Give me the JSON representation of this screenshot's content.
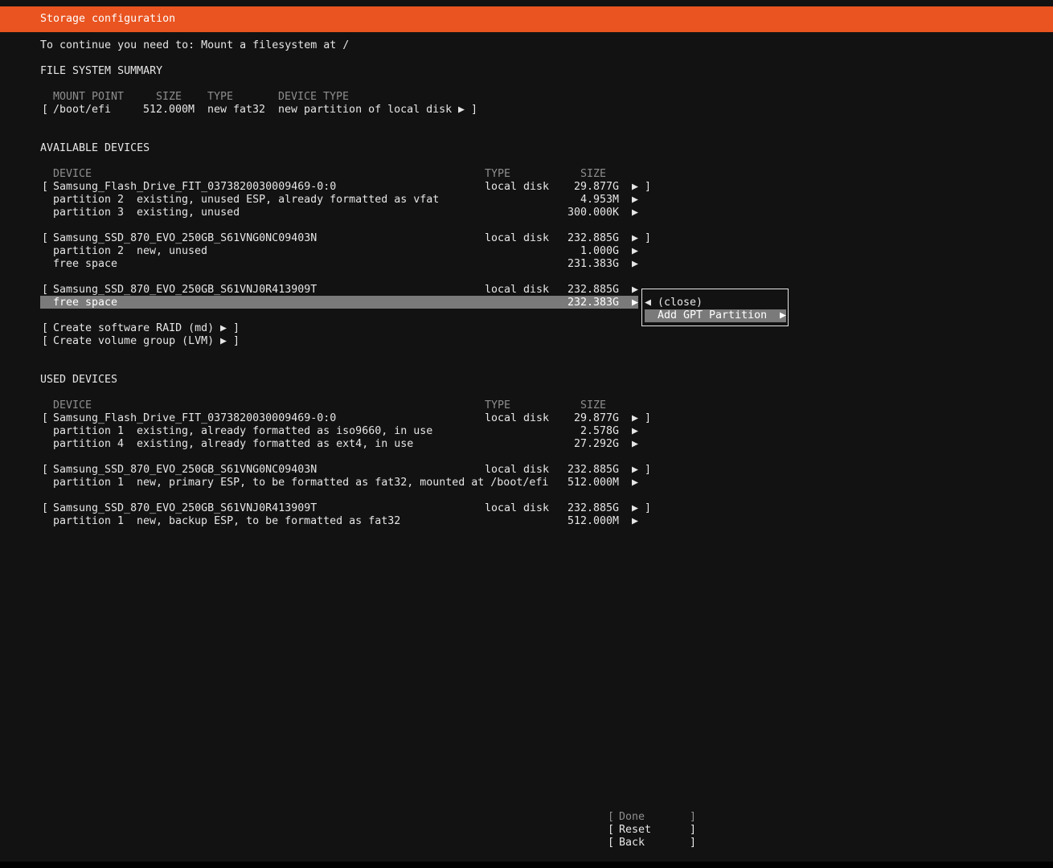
{
  "title_bar": {
    "title": "Storage configuration"
  },
  "instruction": "To continue you need to: Mount a filesystem at /",
  "fs_summary": {
    "heading": "FILE SYSTEM SUMMARY",
    "columns": {
      "mount_point": "MOUNT POINT",
      "size": "SIZE",
      "type": "TYPE",
      "device_type": "DEVICE TYPE"
    },
    "rows": [
      {
        "mount_point": "/boot/efi",
        "size": "512.000M",
        "type": "new fat32",
        "device_type": "new partition of local disk"
      }
    ]
  },
  "available_devices": {
    "heading": "AVAILABLE DEVICES",
    "columns": {
      "device": "DEVICE",
      "type": "TYPE",
      "size": "SIZE"
    },
    "disks": [
      {
        "name": "Samsung_Flash_Drive_FIT_0373820030009469-0:0",
        "type": "local disk",
        "size": "29.877G",
        "partitions": [
          {
            "label": "partition 2",
            "desc": "existing, unused ESP, already formatted as vfat",
            "size": "4.953M"
          },
          {
            "label": "partition 3",
            "desc": "existing, unused",
            "size": "300.000K"
          }
        ]
      },
      {
        "name": "Samsung_SSD_870_EVO_250GB_S61VNG0NC09403N",
        "type": "local disk",
        "size": "232.885G",
        "partitions": [
          {
            "label": "partition 2",
            "desc": "new, unused",
            "size": "1.000G"
          },
          {
            "label": "free space",
            "desc": "",
            "size": "231.383G"
          }
        ]
      },
      {
        "name": "Samsung_SSD_870_EVO_250GB_S61VNJ0R413909T",
        "type": "local disk",
        "size": "232.885G",
        "partitions": [
          {
            "label": "free space",
            "desc": "",
            "size": "232.383G"
          }
        ]
      }
    ],
    "actions": {
      "create_raid": "Create software RAID (md)",
      "create_lvm": "Create volume group (LVM)"
    }
  },
  "context_menu": {
    "close": "(close)",
    "add_gpt": "Add GPT Partition"
  },
  "used_devices": {
    "heading": "USED DEVICES",
    "columns": {
      "device": "DEVICE",
      "type": "TYPE",
      "size": "SIZE"
    },
    "disks": [
      {
        "name": "Samsung_Flash_Drive_FIT_0373820030009469-0:0",
        "type": "local disk",
        "size": "29.877G",
        "partitions": [
          {
            "label": "partition 1",
            "desc": "existing, already formatted as iso9660, in use",
            "size": "2.578G"
          },
          {
            "label": "partition 4",
            "desc": "existing, already formatted as ext4, in use",
            "size": "27.292G"
          }
        ]
      },
      {
        "name": "Samsung_SSD_870_EVO_250GB_S61VNG0NC09403N",
        "type": "local disk",
        "size": "232.885G",
        "partitions": [
          {
            "label": "partition 1",
            "desc": "new, primary ESP, to be formatted as fat32, mounted at /boot/efi",
            "size": "512.000M"
          }
        ]
      },
      {
        "name": "Samsung_SSD_870_EVO_250GB_S61VNJ0R413909T",
        "type": "local disk",
        "size": "232.885G",
        "partitions": [
          {
            "label": "partition 1",
            "desc": "new, backup ESP, to be formatted as fat32",
            "size": "512.000M"
          }
        ]
      }
    ]
  },
  "buttons": {
    "done": "Done",
    "reset": "Reset",
    "back": "Back"
  },
  "colors": {
    "accent": "#e95420",
    "background": "#121212",
    "highlight": "#7a7a7a"
  }
}
